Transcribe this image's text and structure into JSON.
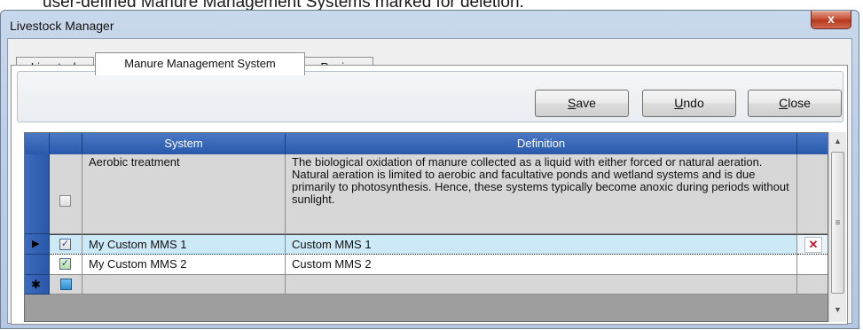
{
  "caption": "user-defined Manure Management Systems marked for deletion.",
  "window": {
    "title": "Livestock Manager",
    "close_glyph": "x"
  },
  "tabs": [
    {
      "label": "Livestock",
      "active": false
    },
    {
      "label": "Manure Management System",
      "active": true
    },
    {
      "label": "Region",
      "active": false
    }
  ],
  "toolbar": {
    "save": {
      "mnemonic": "S",
      "rest": "ave"
    },
    "undo": {
      "mnemonic": "U",
      "rest": "ndo"
    },
    "close": {
      "mnemonic": "C",
      "rest": "lose"
    }
  },
  "grid": {
    "columns": [
      "System",
      "Definition"
    ],
    "rows": [
      {
        "checked": false,
        "system": "Aerobic treatment",
        "definition": "The biological oxidation of manure collected as a liquid with either forced or natural aeration. Natural aeration is limited to aerobic and facultative ponds and wetland systems and is due primarily to photosynthesis. Hence, these systems typically become anoxic during periods without sunlight.",
        "selected": false,
        "delete_marked": false
      },
      {
        "checked": true,
        "system": "My Custom MMS 1",
        "definition": "Custom MMS 1",
        "selected": true,
        "delete_marked": true
      },
      {
        "checked": true,
        "system": "My Custom MMS 2",
        "definition": "Custom MMS 2",
        "selected": false,
        "delete_marked": false
      }
    ],
    "current_row_glyph": "▶",
    "new_row_glyph": "✱",
    "delete_glyph": "✕"
  },
  "scrollbar": {
    "up": "▲",
    "down": "▼",
    "grip": "≡"
  },
  "colors": {
    "header_blue": "#2a59ad",
    "selected_row": "#cce9f7",
    "delete_red": "#c8102e"
  }
}
